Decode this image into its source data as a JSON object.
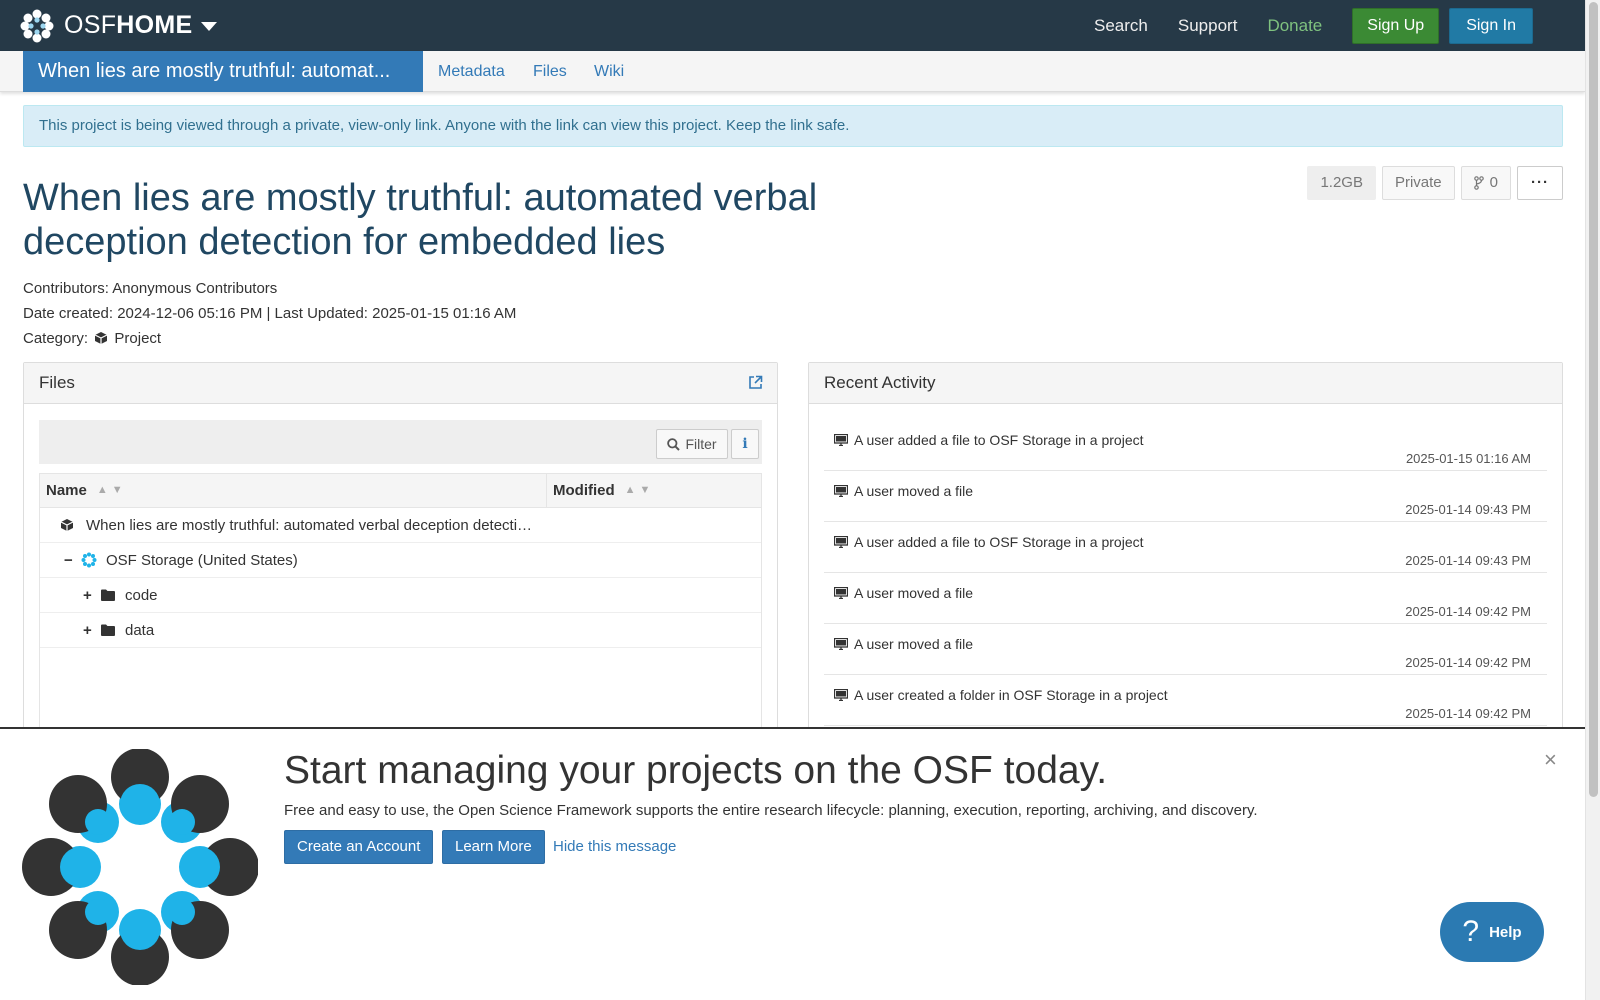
{
  "topnav": {
    "brand_light": "OSF",
    "brand_bold": "HOME",
    "links": [
      "Search",
      "Support",
      "Donate"
    ],
    "signup": "Sign Up",
    "signin": "Sign In"
  },
  "projnav": {
    "title": "When lies are mostly truthful: automat...",
    "tabs": [
      "Metadata",
      "Files",
      "Wiki"
    ]
  },
  "alert": "This project is being viewed through a private, view-only link. Anyone with the link can view this project. Keep the link safe.",
  "project": {
    "title": "When lies are mostly truthful: automated verbal deception detection for embedded lies",
    "contributors": "Contributors: Anonymous Contributors",
    "dates": "Date created: 2024-12-06 05:16 PM | Last Updated: 2025-01-15 01:16 AM",
    "category_label": "Category:",
    "category_value": "Project",
    "size": "1.2GB",
    "visibility": "Private",
    "forks": "0",
    "more": "···"
  },
  "files": {
    "heading": "Files",
    "filter": "Filter",
    "info": "i",
    "col_name": "Name",
    "col_modified": "Modified",
    "rows": [
      {
        "label": "When lies are mostly truthful: automated verbal deception detecti…",
        "icon": "cube-icon"
      },
      {
        "label": "OSF Storage (United States)",
        "icon": "osf-storage-icon",
        "toggle": "−"
      },
      {
        "label": "code",
        "icon": "folder-icon",
        "toggle": "+"
      },
      {
        "label": "data",
        "icon": "folder-icon",
        "toggle": "+"
      }
    ]
  },
  "activity": {
    "heading": "Recent Activity",
    "items": [
      {
        "text": "A user added a file to OSF Storage in a project",
        "date": "2025-01-15 01:16 AM"
      },
      {
        "text": "A user moved a file",
        "date": "2025-01-14 09:43 PM"
      },
      {
        "text": "A user added a file to OSF Storage in a project",
        "date": "2025-01-14 09:43 PM"
      },
      {
        "text": "A user moved a file",
        "date": "2025-01-14 09:42 PM"
      },
      {
        "text": "A user moved a file",
        "date": "2025-01-14 09:42 PM"
      },
      {
        "text": "A user created a folder in OSF Storage in a project",
        "date": "2025-01-14 09:42 PM"
      }
    ]
  },
  "banner": {
    "title": "Start managing your projects on the OSF today.",
    "subtitle": "Free and easy to use, the Open Science Framework supports the entire research lifecycle: planning, execution, reporting, archiving, and discovery.",
    "create": "Create an Account",
    "learn": "Learn More",
    "hide": "Hide this message",
    "close": "×"
  },
  "help": {
    "label": "Help",
    "glyph": "?"
  },
  "colors": {
    "navbar": "#263947",
    "primary": "#337ab7",
    "signup": "#3b8a34",
    "donate": "#7fc27f",
    "osf_blue": "#1fb3e8",
    "osf_dark": "#333333"
  }
}
